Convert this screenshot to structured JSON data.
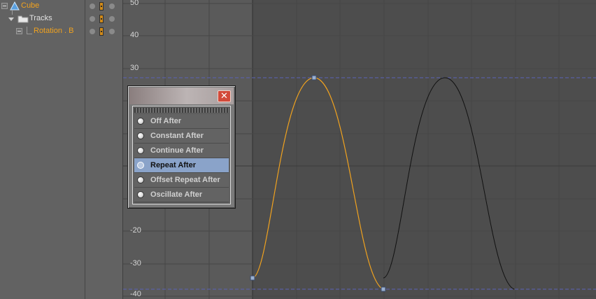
{
  "tree": {
    "items": [
      {
        "label": "Cube",
        "icon": "cube-icon",
        "color": "#f0a21f"
      },
      {
        "label": "Tracks",
        "icon": "folder-icon",
        "color": "#e2e2e2"
      },
      {
        "label": "Rotation . B",
        "icon": "curve-track-icon",
        "color": "#f0a21f"
      }
    ]
  },
  "graph": {
    "y_ticks": [
      "50",
      "40",
      "30",
      "-20",
      "-30",
      "-40"
    ],
    "selected_curve_color": "#f0a21f",
    "cycle_curve_color": "#111111",
    "limit_line_color": "#5a62b8"
  },
  "dialog": {
    "close_label": "✕",
    "options": [
      {
        "label": "Off After",
        "selected": false
      },
      {
        "label": "Constant After",
        "selected": false
      },
      {
        "label": "Continue After",
        "selected": false
      },
      {
        "label": "Repeat After",
        "selected": true
      },
      {
        "label": "Offset Repeat After",
        "selected": false
      },
      {
        "label": "Oscillate After",
        "selected": false
      }
    ]
  }
}
